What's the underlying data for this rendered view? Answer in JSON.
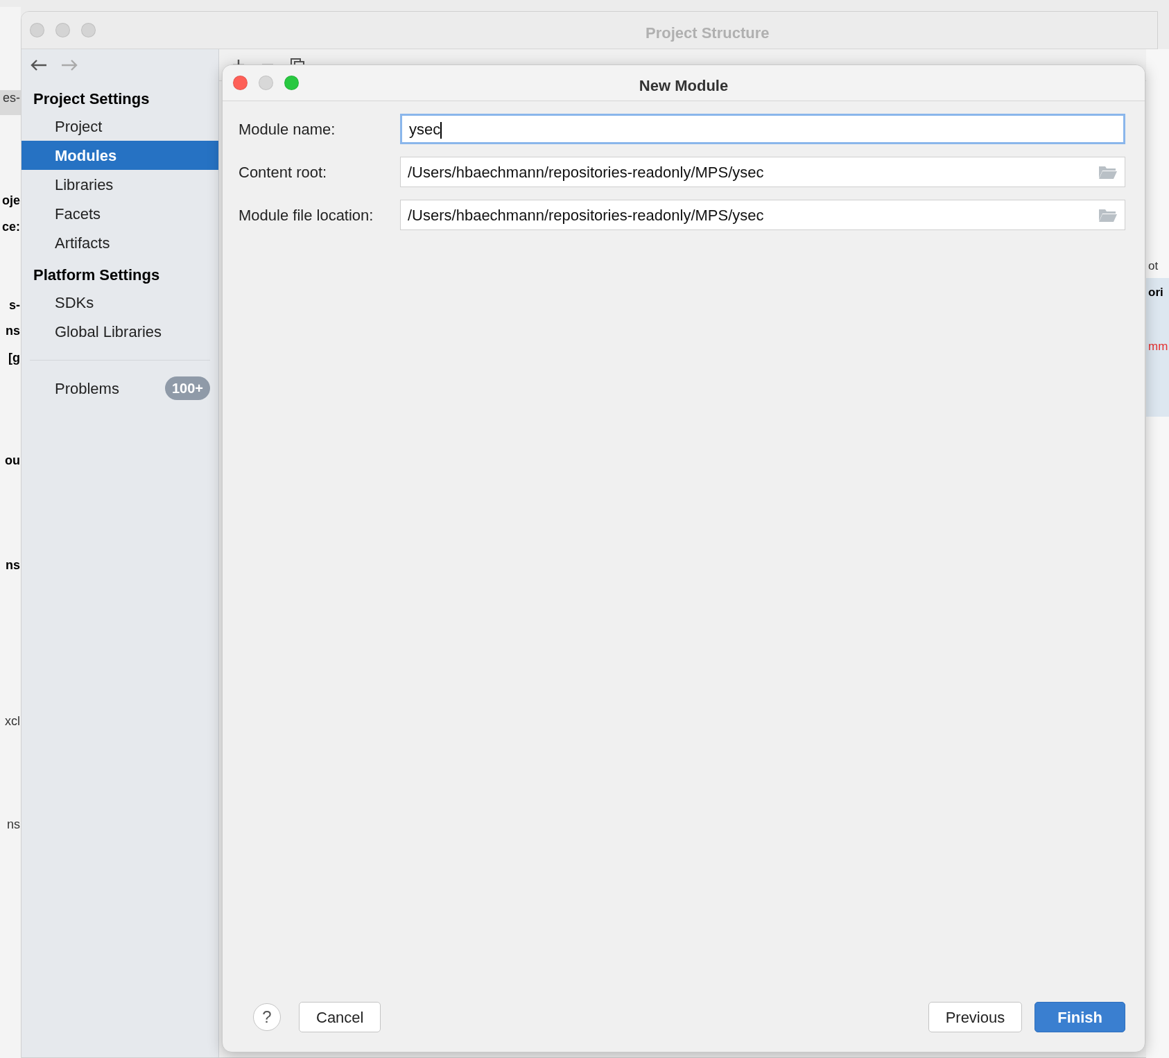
{
  "background_window": {
    "left_fragments": [
      {
        "text": "es-",
        "kind": "plain"
      },
      {
        "text": "oje",
        "kind": "bold"
      },
      {
        "text": "ce:",
        "kind": "bold"
      },
      {
        "text": "s-",
        "kind": "bold"
      },
      {
        "text": "ns",
        "kind": "bold"
      },
      {
        "text": "[g",
        "kind": "bold"
      },
      {
        "text": "ou",
        "kind": "bold"
      },
      {
        "text": "ns",
        "kind": "bold"
      },
      {
        "text": "xcl",
        "kind": "plain"
      },
      {
        "text": "ns",
        "kind": "plain"
      }
    ],
    "right_fragments": [
      {
        "text": "ot",
        "kind": "plain"
      },
      {
        "text": "ori",
        "kind": "bold"
      },
      {
        "text": "mm",
        "kind": "error"
      }
    ]
  },
  "main_window": {
    "title": "Project Structure",
    "sidebar": {
      "sections": [
        {
          "heading": "Project Settings",
          "items": [
            {
              "label": "Project",
              "selected": false
            },
            {
              "label": "Modules",
              "selected": true
            },
            {
              "label": "Libraries",
              "selected": false
            },
            {
              "label": "Facets",
              "selected": false
            },
            {
              "label": "Artifacts",
              "selected": false
            }
          ]
        },
        {
          "heading": "Platform Settings",
          "items": [
            {
              "label": "SDKs",
              "selected": false
            },
            {
              "label": "Global Libraries",
              "selected": false
            }
          ]
        }
      ],
      "problems": {
        "label": "Problems",
        "badge": "100+"
      }
    }
  },
  "dialog": {
    "title": "New Module",
    "fields": [
      {
        "label": "Module name:",
        "value": "ysec",
        "focused": true,
        "browse": false
      },
      {
        "label": "Content root:",
        "value": "/Users/hbaechmann/repositories-readonly/MPS/ysec",
        "focused": false,
        "browse": true
      },
      {
        "label": "Module file location:",
        "value": "/Users/hbaechmann/repositories-readonly/MPS/ysec",
        "focused": false,
        "browse": true
      }
    ],
    "buttons": [
      {
        "label": "?",
        "kind": "help"
      },
      {
        "label": "Cancel",
        "kind": "normal"
      },
      {
        "label": "Previous",
        "kind": "normal"
      },
      {
        "label": "Finish",
        "kind": "default"
      }
    ]
  }
}
